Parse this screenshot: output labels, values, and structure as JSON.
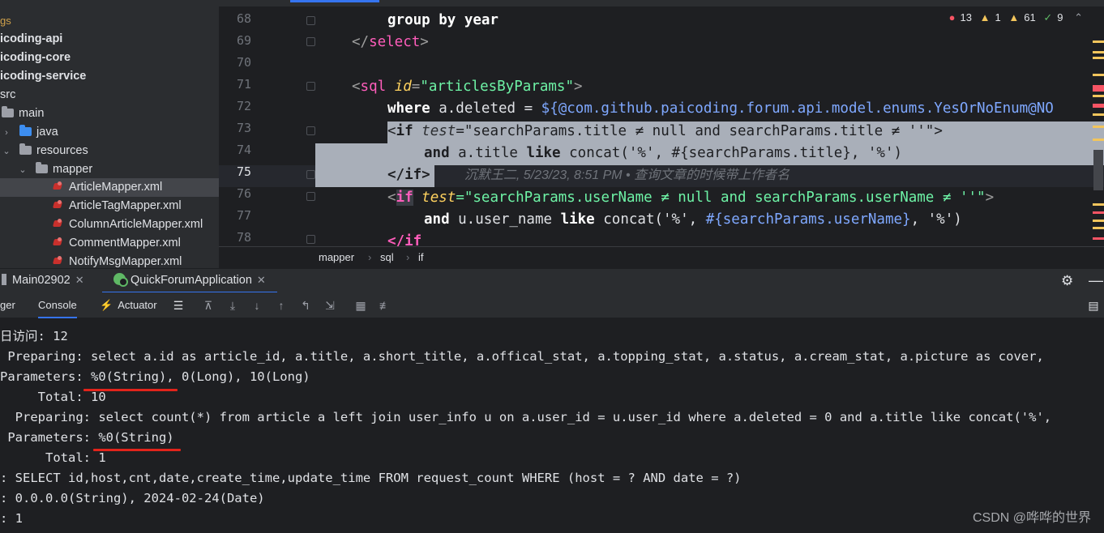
{
  "project_tree": {
    "items": [
      {
        "label": "gs",
        "kind": "muted"
      },
      {
        "label": "icoding-api",
        "kind": "module"
      },
      {
        "label": "icoding-core",
        "kind": "module"
      },
      {
        "label": "icoding-service",
        "kind": "module"
      },
      {
        "label": "src",
        "kind": "folder"
      },
      {
        "label": "main",
        "kind": "folder"
      },
      {
        "label": "java",
        "kind": "source-folder"
      },
      {
        "label": "resources",
        "kind": "resource-folder"
      },
      {
        "label": "mapper",
        "kind": "folder"
      },
      {
        "label": "ArticleMapper.xml",
        "kind": "xml",
        "selected": true
      },
      {
        "label": "ArticleTagMapper.xml",
        "kind": "xml"
      },
      {
        "label": "ColumnArticleMapper.xml",
        "kind": "xml"
      },
      {
        "label": "CommentMapper.xml",
        "kind": "xml"
      },
      {
        "label": "NotifyMsgMapper.xml",
        "kind": "xml"
      }
    ]
  },
  "editor": {
    "line_numbers": [
      "68",
      "69",
      "70",
      "71",
      "72",
      "73",
      "74",
      "75",
      "76",
      "77",
      "78"
    ],
    "current_line": "75",
    "problems": {
      "errors": "13",
      "warnings": "1",
      "weak_warnings": "61",
      "typos": "9"
    },
    "code": {
      "l68_kw": "group by year",
      "l69_open": "</",
      "l69_tag": "select",
      "l69_close": ">",
      "l71_open": "<",
      "l71_tag": "sql",
      "l71_attr": "id",
      "l71_eq": "=",
      "l71_val": "\"articlesByParams\"",
      "l71_close": ">",
      "l72_kw": "where",
      "l72_plain": " a.deleted = ",
      "l72_ognl": "${@com.github.paicoding.forum.api.model.enums.YesOrNoEnum@NO",
      "l73_lt": "<",
      "l73_tag": "if",
      "l73_attr": "test",
      "l73_val": "=\"searchParams.title ≠ null and searchParams.title ≠ ''\"",
      "l73_gt": ">",
      "l74_kw1": "and",
      "l74_plain1": " a.title ",
      "l74_kw2": "like",
      "l74_plain2": " concat('%', #{searchParams.title}, '%')",
      "l75_tag": "</if>",
      "l75_hint": "沉默王二, 5/23/23, 8:51 PM • 查询文章的时候带上作者名",
      "l76_lt": "<",
      "l76_tag": "if",
      "l76_attr": "test",
      "l76_val": "=\"searchParams.userName ≠ null and searchParams.userName ≠ ''\"",
      "l76_gt": ">",
      "l77_kw1": "and",
      "l77_plain1": " u.user_name ",
      "l77_kw2": "like",
      "l77_plain2": " concat('%', ",
      "l77_ognl": "#{searchParams.userName}",
      "l77_plain3": ", '%')",
      "l78_tag": "</if"
    },
    "breadcrumb": [
      "mapper",
      "sql",
      "if"
    ]
  },
  "run_panel": {
    "tabs": [
      {
        "label": "Main02902"
      },
      {
        "label": "QuickForumApplication",
        "active": true
      }
    ],
    "toolbar_tabs": [
      "ger",
      "Console",
      "Actuator"
    ],
    "console_lines": [
      "日访问: 12",
      " Preparing: select a.id as article_id, a.title, a.short_title, a.offical_stat, a.topping_stat, a.status, a.cream_stat, a.picture as cover,",
      "Parameters: %0(String), 0(Long), 10(Long)",
      "     Total: 10",
      "  Preparing: select count(*) from article a left join user_info u on a.user_id = u.user_id where a.deleted = 0 and a.title like concat('%',",
      " Parameters: %0(String)",
      "      Total: 1",
      ": SELECT id,host,cnt,date,create_time,update_time FROM request_count WHERE (host = ? AND date = ?)",
      ": 0.0.0.0(String), 2024-02-24(Date)",
      ": 1"
    ],
    "watermark": "CSDN @哗哗的世界"
  },
  "colors": {
    "accent": "#3574f0",
    "error": "#f75464",
    "warning": "#f2c55c",
    "annotation_underline": "#e2241b"
  }
}
